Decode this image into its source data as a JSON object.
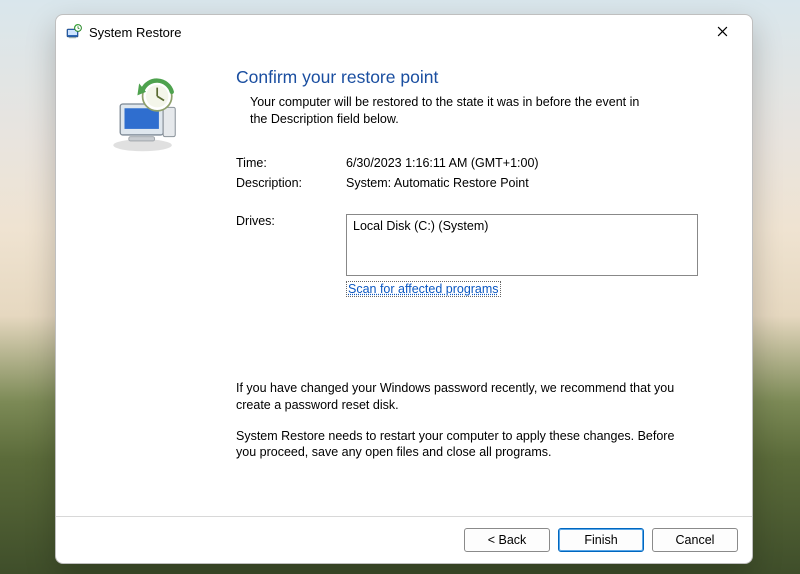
{
  "window": {
    "title": "System Restore"
  },
  "content": {
    "heading": "Confirm your restore point",
    "subheading": "Your computer will be restored to the state it was in before the event in the Description field below.",
    "time_label": "Time:",
    "time_value": "6/30/2023 1:16:11 AM (GMT+1:00)",
    "desc_label": "Description:",
    "desc_value": "System: Automatic Restore Point",
    "drives_label": "Drives:",
    "drives_value": "Local Disk (C:) (System)",
    "scan_link": "Scan for affected programs",
    "para1": "If you have changed your Windows password recently, we recommend that you create a password reset disk.",
    "para2": "System Restore needs to restart your computer to apply these changes. Before you proceed, save any open files and close all programs."
  },
  "footer": {
    "back": "< Back",
    "finish": "Finish",
    "cancel": "Cancel"
  }
}
